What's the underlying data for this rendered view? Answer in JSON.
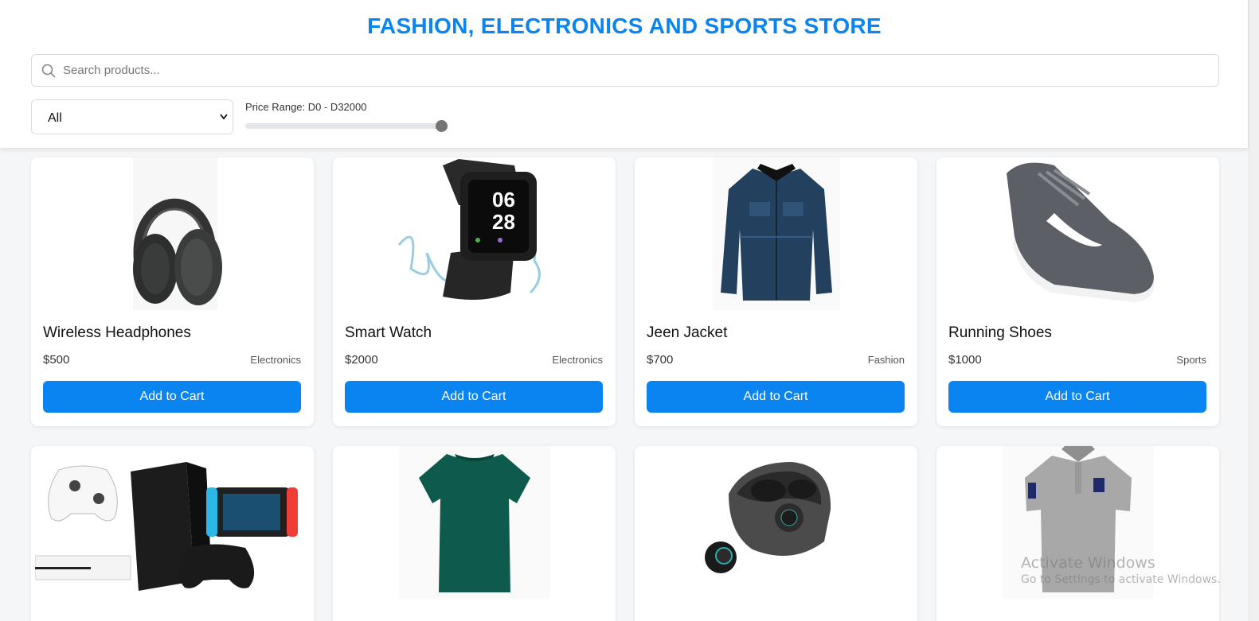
{
  "header": {
    "title": "FASHION, ELECTRONICS AND SPORTS STORE",
    "search_placeholder": "Search products...",
    "category_selected": "All",
    "price_range_label": "Price Range: D0 - D32000",
    "price_slider_fraction": 1.0
  },
  "products": [
    {
      "name": "Wireless Headphones",
      "price": "$500",
      "category": "Electronics",
      "button": "Add to Cart",
      "image_icon": "headphones-icon"
    },
    {
      "name": "Smart Watch",
      "price": "$2000",
      "category": "Electronics",
      "button": "Add to Cart",
      "image_icon": "smartwatch-icon"
    },
    {
      "name": "Jeen Jacket",
      "price": "$700",
      "category": "Fashion",
      "button": "Add to Cart",
      "image_icon": "jacket-icon"
    },
    {
      "name": "Running Shoes",
      "price": "$1000",
      "category": "Sports",
      "button": "Add to Cart",
      "image_icon": "shoe-icon"
    },
    {
      "image_icon": "game-consoles-icon"
    },
    {
      "image_icon": "tshirt-icon"
    },
    {
      "image_icon": "earbuds-icon"
    },
    {
      "image_icon": "polo-shirt-icon"
    }
  ],
  "watermark": {
    "title": "Activate Windows",
    "subtitle": "Go to Settings to activate Windows."
  },
  "colors": {
    "accent": "#0a84f0",
    "background": "#f4f6f8"
  }
}
